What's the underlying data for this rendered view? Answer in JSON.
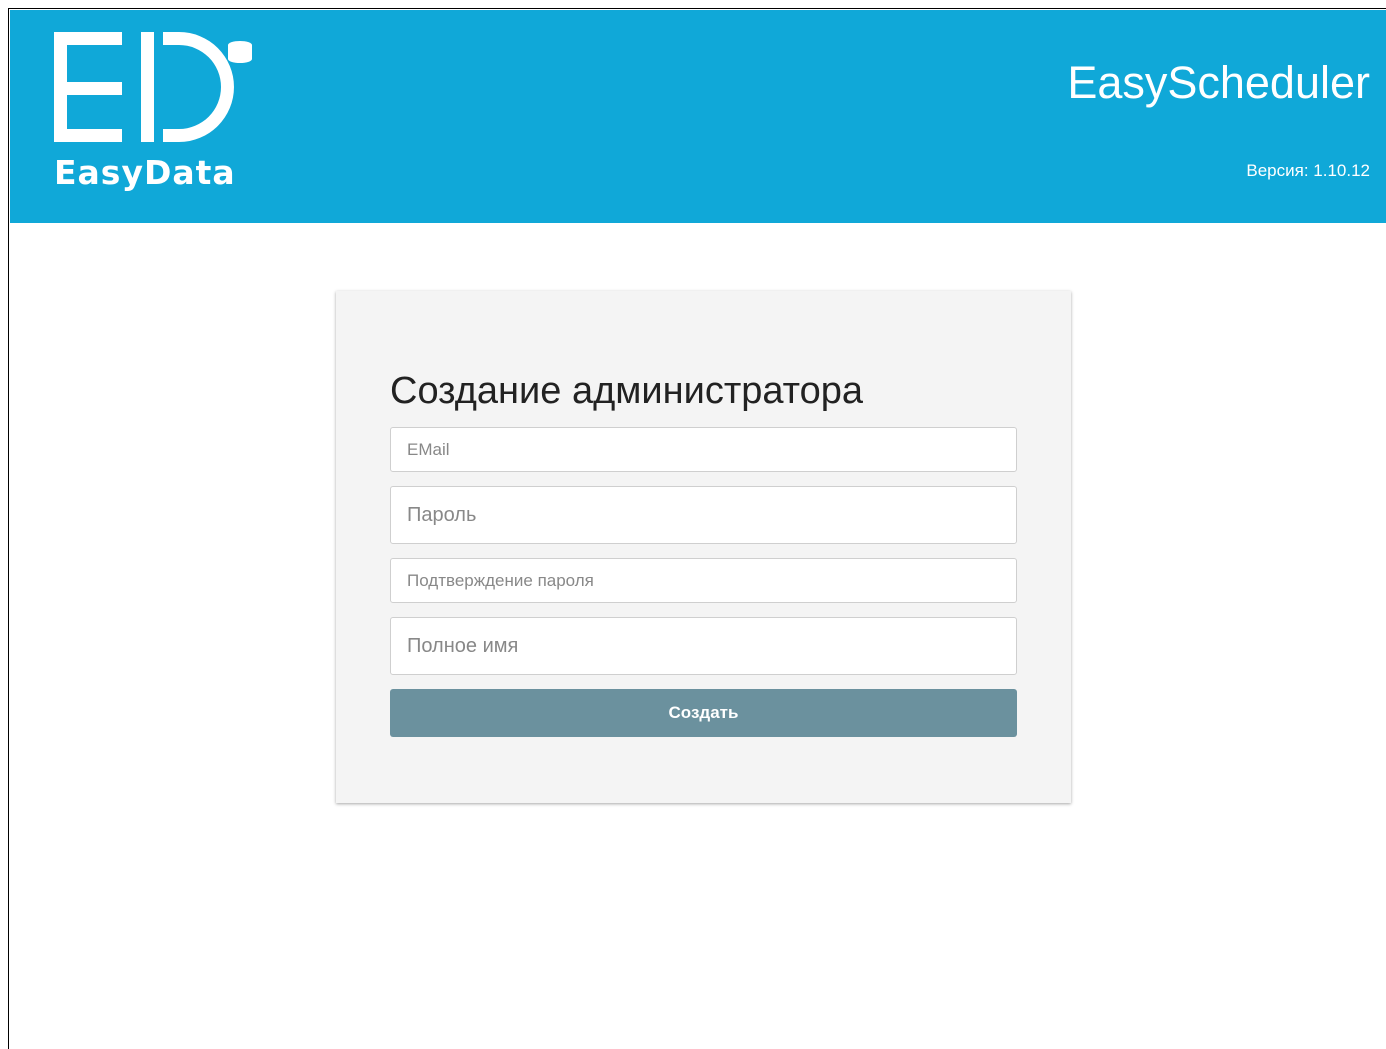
{
  "header": {
    "logo_text": "EasyData",
    "app_title": "EasyScheduler",
    "version": "Версия: 1.10.12",
    "background_color": "#10a8d8"
  },
  "form": {
    "title": "Создание администратора",
    "email_placeholder": "EMail",
    "password_placeholder": "Пароль",
    "confirm_placeholder": "Подтверждение пароля",
    "fullname_placeholder": "Полное имя",
    "submit_label": "Создать",
    "button_color": "#6b919e"
  }
}
